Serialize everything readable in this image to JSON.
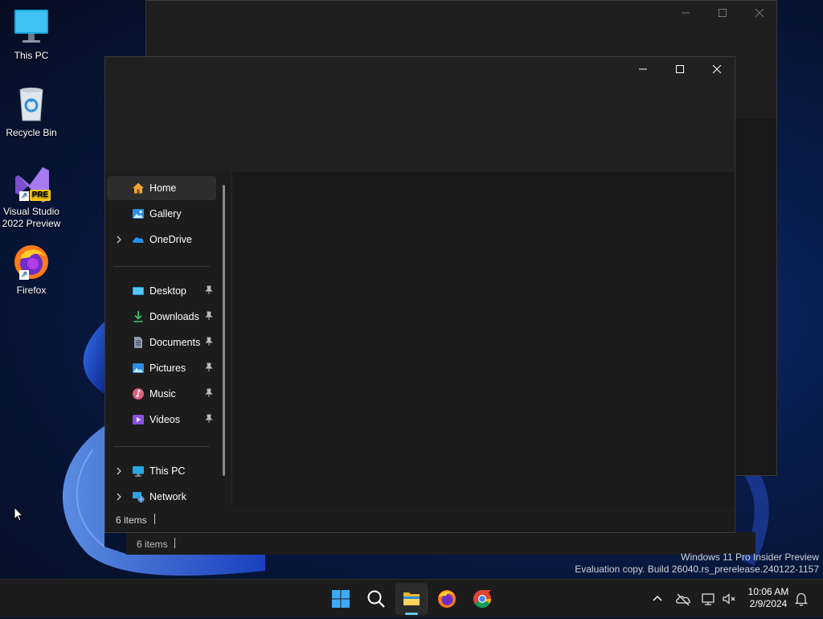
{
  "desktop": {
    "icons": [
      {
        "label": "This PC",
        "icon": "monitor-icon"
      },
      {
        "label": "Recycle Bin",
        "icon": "recycle-bin-icon"
      },
      {
        "label": "Visual Studio\n2022 Preview",
        "icon": "visual-studio-icon",
        "badge": "PRE"
      },
      {
        "label": "Firefox",
        "icon": "firefox-icon"
      }
    ],
    "watermark": {
      "line1": "Windows 11 Pro Insider Preview",
      "line2": "Evaluation copy. Build 26040.rs_prerelease.240122-1157"
    }
  },
  "back_window": {
    "status_text": "6 items"
  },
  "explorer": {
    "nav_quick": [
      {
        "label": "Home",
        "icon": "home-icon",
        "selected": true
      },
      {
        "label": "Gallery",
        "icon": "gallery-icon"
      },
      {
        "label": "OneDrive",
        "icon": "onedrive-icon",
        "expandable": true
      }
    ],
    "nav_pinned": [
      {
        "label": "Desktop",
        "icon": "desktop-folder-icon"
      },
      {
        "label": "Downloads",
        "icon": "downloads-icon"
      },
      {
        "label": "Documents",
        "icon": "documents-icon"
      },
      {
        "label": "Pictures",
        "icon": "pictures-icon"
      },
      {
        "label": "Music",
        "icon": "music-icon"
      },
      {
        "label": "Videos",
        "icon": "videos-icon"
      }
    ],
    "nav_bottom": [
      {
        "label": "This PC",
        "icon": "this-pc-icon"
      },
      {
        "label": "Network",
        "icon": "network-icon"
      }
    ],
    "status_text": "6 items"
  },
  "taskbar": {
    "apps": [
      "start-icon",
      "search-icon",
      "file-explorer-icon",
      "firefox-icon",
      "chrome-icon"
    ],
    "active_app": "file-explorer-icon",
    "time": "10:06 AM",
    "date": "2/9/2024"
  },
  "colors": {
    "accent": "#60cdff",
    "window_bg": "#1c1c1c",
    "taskbar_bg": "#1c1c1c"
  }
}
